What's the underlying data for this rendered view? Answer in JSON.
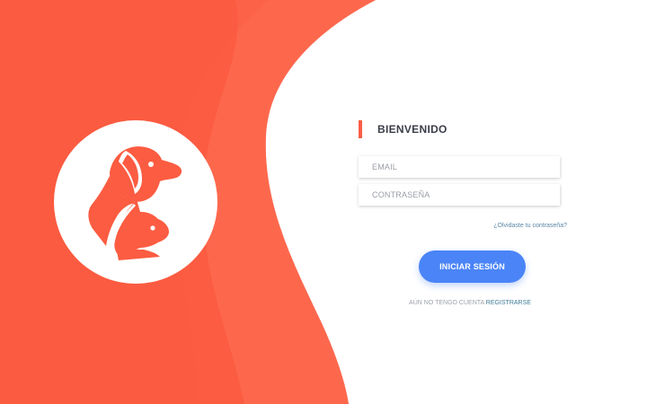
{
  "welcome": {
    "title": "BIENVENIDO"
  },
  "form": {
    "email_placeholder": "EMAIL",
    "password_placeholder": "CONTRASEÑA",
    "forgot_label": "¿Olvidaste tu contraseña?",
    "login_label": "INICIAR SESIÓN",
    "no_account_label": "AÚN NO TENGO CUENTA",
    "register_label": "REGISTRARSE"
  },
  "logo": {
    "icon": "dog-and-cat-icon"
  },
  "colors": {
    "brand": "#fb5e45",
    "primary_button": "#4a84f7",
    "link": "#3e7a97"
  }
}
